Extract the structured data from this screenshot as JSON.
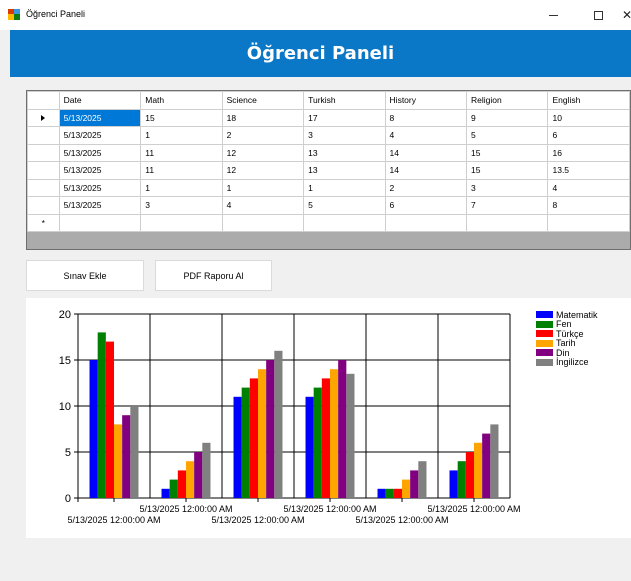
{
  "window": {
    "title": "Öğrenci Paneli",
    "min_glyph": "–",
    "max_glyph": "□",
    "close_glyph": "✕"
  },
  "header": {
    "title": "Öğrenci Paneli"
  },
  "grid": {
    "columns": [
      "Date",
      "Math",
      "Science",
      "Turkish",
      "History",
      "Religion",
      "English"
    ],
    "rows": [
      [
        "5/13/2025",
        "15",
        "18",
        "17",
        "8",
        "9",
        "10"
      ],
      [
        "5/13/2025",
        "1",
        "2",
        "3",
        "4",
        "5",
        "6"
      ],
      [
        "5/13/2025",
        "11",
        "12",
        "13",
        "14",
        "15",
        "16"
      ],
      [
        "5/13/2025",
        "11",
        "12",
        "13",
        "14",
        "15",
        "13.5"
      ],
      [
        "5/13/2025",
        "1",
        "1",
        "1",
        "2",
        "3",
        "4"
      ],
      [
        "5/13/2025",
        "3",
        "4",
        "5",
        "6",
        "7",
        "8"
      ]
    ],
    "new_row_marker": "*"
  },
  "buttons": {
    "add_exam": "Sınav Ekle",
    "pdf_report": "PDF Raporu Al"
  },
  "chart_data": {
    "type": "bar",
    "categories": [
      "5/13/2025 12:00:00 AM",
      "5/13/2025 12:00:00 AM",
      "5/13/2025 12:00:00 AM",
      "5/13/2025 12:00:00 AM",
      "5/13/2025 12:00:00 AM",
      "5/13/2025 12:00:00 AM"
    ],
    "series": [
      {
        "name": "Matematik",
        "color": "#0000ff",
        "values": [
          15,
          1,
          11,
          11,
          1,
          3
        ]
      },
      {
        "name": "Fen",
        "color": "#008000",
        "values": [
          18,
          2,
          12,
          12,
          1,
          4
        ]
      },
      {
        "name": "Türkçe",
        "color": "#ff0000",
        "values": [
          17,
          3,
          13,
          13,
          1,
          5
        ]
      },
      {
        "name": "Tarih",
        "color": "#ffa500",
        "values": [
          8,
          4,
          14,
          14,
          2,
          6
        ]
      },
      {
        "name": "Din",
        "color": "#800080",
        "values": [
          9,
          5,
          15,
          15,
          3,
          7
        ]
      },
      {
        "name": "İngilizce",
        "color": "#808080",
        "values": [
          10,
          6,
          16,
          13.5,
          4,
          8
        ]
      }
    ],
    "ylim": [
      0,
      20
    ],
    "yticks": [
      "0",
      "5",
      "10",
      "15",
      "20"
    ],
    "grid": true,
    "legend": "top-right"
  }
}
